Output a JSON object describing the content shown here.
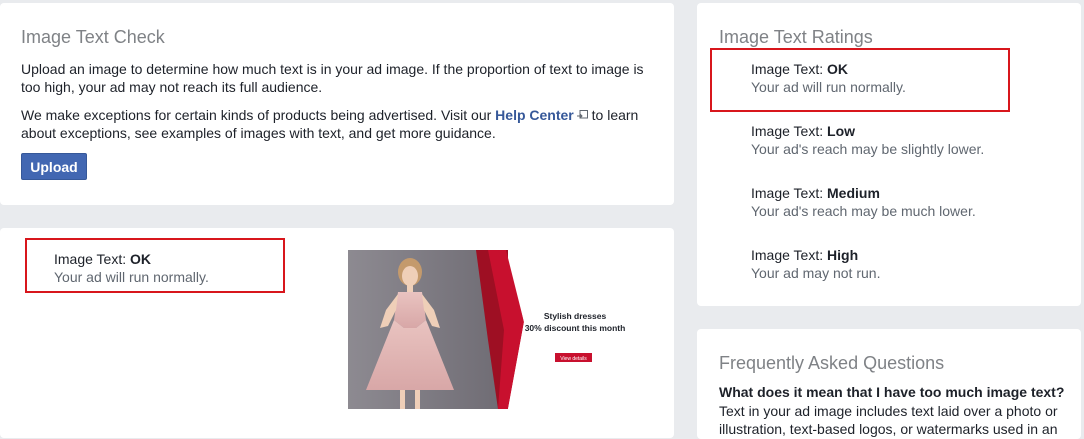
{
  "check": {
    "title": "Image Text Check",
    "para1": "Upload an image to determine how much text is in your ad image. If the proportion of text to image is too high, your ad may not reach its full audience.",
    "para2_before": "We make exceptions for certain kinds of products being advertised. Visit our ",
    "help_link": "Help Center",
    "para2_after": " to learn about exceptions, see examples of images with text, and get more guidance.",
    "upload_label": "Upload"
  },
  "result": {
    "label": "Image Text: ",
    "value": "OK",
    "desc": "Your ad will run normally."
  },
  "ad": {
    "headline_line1": "Stylish dresses",
    "headline_line2": "30% discount this month",
    "button_label": "View details",
    "accent_color": "#c8102e"
  },
  "ratings": {
    "title": "Image Text Ratings",
    "items": [
      {
        "label": "Image Text: ",
        "value": "OK",
        "desc": "Your ad will run normally."
      },
      {
        "label": "Image Text: ",
        "value": "Low",
        "desc": "Your ad's reach may be slightly lower."
      },
      {
        "label": "Image Text: ",
        "value": "Medium",
        "desc": "Your ad's reach may be much lower."
      },
      {
        "label": "Image Text: ",
        "value": "High",
        "desc": "Your ad may not run."
      }
    ]
  },
  "faq": {
    "title": "Frequently Asked Questions",
    "question": "What does it mean that I have too much image text?",
    "answer_line1": "Text in your ad image includes text laid over a photo or",
    "answer_line2": "illustration, text-based logos, or watermarks used in an"
  }
}
